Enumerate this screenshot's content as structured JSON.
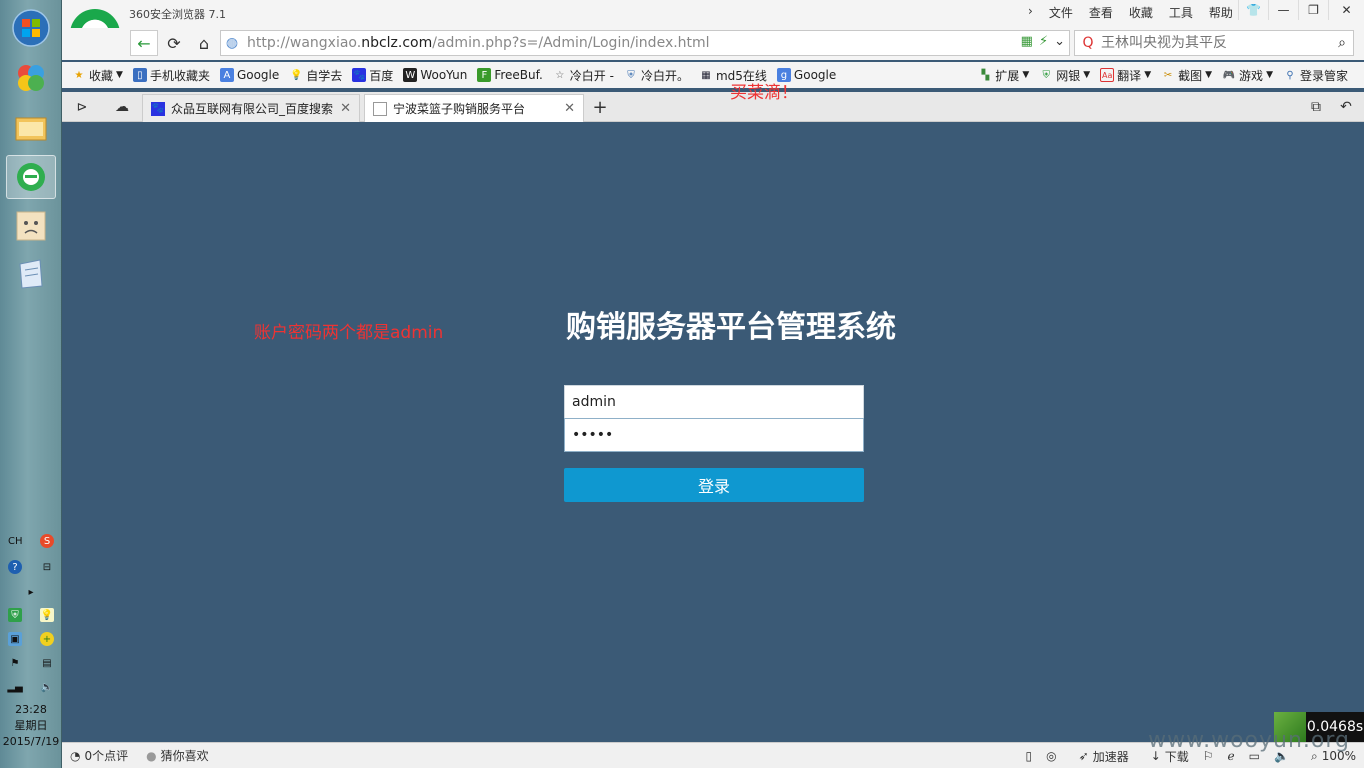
{
  "browser": {
    "app_title": "360安全浏览器 7.1",
    "menus": [
      "文件",
      "查看",
      "收藏",
      "工具",
      "帮助"
    ],
    "address": {
      "prefix": "http://wangxiao.",
      "domain": "nbclz.com",
      "suffix": "/admin.php?s=/Admin/Login/index.html"
    },
    "search_placeholder": "王林叫央视为其平反",
    "bookmarks_left": [
      {
        "label": "收藏",
        "icon": "star-icon"
      },
      {
        "label": "手机收藏夹",
        "icon": "phone-icon"
      },
      {
        "label": "Google",
        "icon": "google-translate-icon"
      },
      {
        "label": "自学去",
        "icon": "bulb-icon"
      },
      {
        "label": "百度",
        "icon": "baidu-paw-icon"
      },
      {
        "label": "WooYun",
        "icon": "wooyun-icon"
      },
      {
        "label": "FreeBuf.",
        "icon": "freebuf-icon"
      },
      {
        "label": "冷白开 -",
        "icon": "star-outline-icon"
      },
      {
        "label": "冷白开。",
        "icon": "shield-icon"
      },
      {
        "label": "md5在线",
        "icon": "grid-icon"
      },
      {
        "label": "Google",
        "icon": "google-icon"
      }
    ],
    "bookmarks_right": [
      {
        "label": "扩展",
        "icon": "puzzle-icon"
      },
      {
        "label": "网银",
        "icon": "bank-icon"
      },
      {
        "label": "翻译",
        "icon": "translate-icon"
      },
      {
        "label": "截图",
        "icon": "scissors-icon"
      },
      {
        "label": "游戏",
        "icon": "gamepad-icon"
      },
      {
        "label": "登录管家",
        "icon": "key-icon"
      }
    ],
    "tabs": [
      {
        "label": "众品互联网有限公司_百度搜索",
        "active": false
      },
      {
        "label": "宁波菜篮子购销服务平台",
        "active": true
      }
    ]
  },
  "page": {
    "annotation_left": "账户密码两个都是admin",
    "annotation_top": "买菜滴！",
    "title": "购销服务器平台管理系统",
    "username_value": "admin",
    "password_value": "admin",
    "login_label": "登录"
  },
  "timer": "0.0468s",
  "status": {
    "left": [
      "0个点评",
      "猜你喜欢"
    ],
    "right": [
      "加速器",
      "下载",
      "100%"
    ]
  },
  "watermark": "www.wooyun.org",
  "taskbar": {
    "clock_time": "23:28",
    "clock_day": "星期日",
    "clock_date": "2015/7/19",
    "lang": "CH"
  }
}
